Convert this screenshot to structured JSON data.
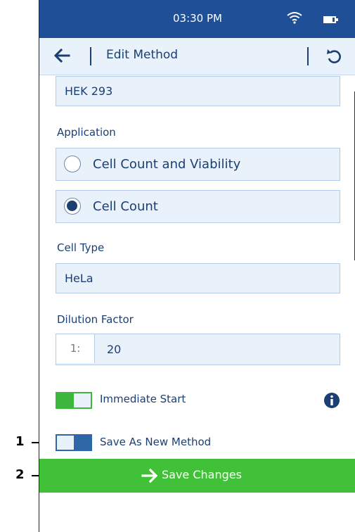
{
  "callouts": [
    "1",
    "2"
  ],
  "status": {
    "time": "03:30 PM"
  },
  "header": {
    "title": "Edit Method"
  },
  "form": {
    "name_value": "HEK 293",
    "application_label": "Application",
    "application_options": [
      {
        "label": "Cell Count and Viability",
        "selected": false
      },
      {
        "label": "Cell Count",
        "selected": true
      }
    ],
    "cell_type_label": "Cell Type",
    "cell_type_value": "HeLa",
    "dilution_label": "Dilution Factor",
    "dilution_prefix": "1:",
    "dilution_value": "20"
  },
  "toggles": {
    "immediate_start": {
      "label": "Immediate Start",
      "on": true
    },
    "save_as_new": {
      "label": "Save As New Method",
      "on": false
    }
  },
  "actions": {
    "save_label": "Save Changes"
  },
  "colors": {
    "header_blue": "#1f4f97",
    "field_bg": "#e9f2fb",
    "text_blue": "#1b3f73",
    "accent_green": "#41c138",
    "toggle_blue": "#2f66a6"
  },
  "icons": [
    "back-arrow-icon",
    "reset-icon",
    "wifi-icon",
    "battery-icon",
    "info-icon",
    "arrow-right-icon"
  ]
}
